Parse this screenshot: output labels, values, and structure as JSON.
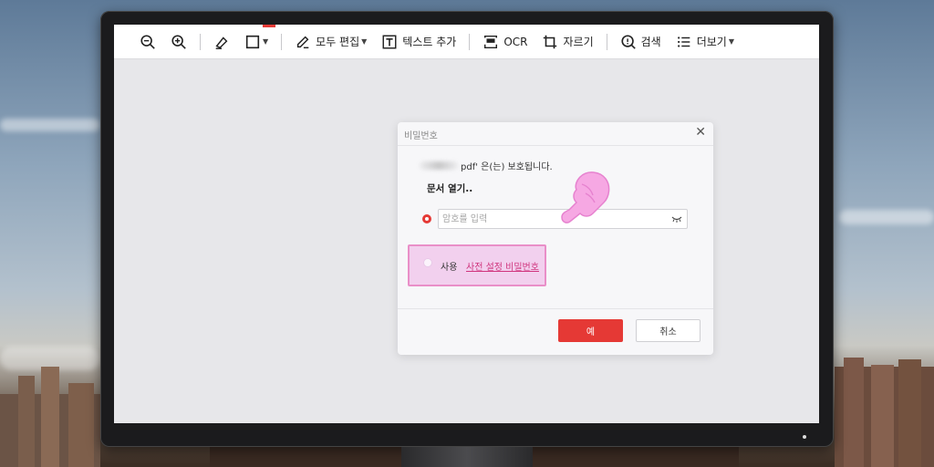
{
  "toolbar": {
    "items": [
      {
        "id": "zoom-out",
        "icon": "zoom-out-icon",
        "label": ""
      },
      {
        "id": "zoom-in",
        "icon": "zoom-in-icon",
        "label": ""
      },
      {
        "id": "highlight",
        "icon": "highlighter-icon",
        "label": ""
      },
      {
        "id": "shape",
        "icon": "rectangle-icon",
        "label": ""
      },
      {
        "id": "edit-all",
        "icon": "edit-icon",
        "label": "모두 편집"
      },
      {
        "id": "add-text",
        "icon": "text-box-icon",
        "label": "텍스트 추가"
      },
      {
        "id": "ocr",
        "icon": "ocr-icon",
        "label": "OCR"
      },
      {
        "id": "crop",
        "icon": "crop-icon",
        "label": "자르기"
      },
      {
        "id": "search",
        "icon": "search-icon",
        "label": "검색"
      },
      {
        "id": "more",
        "icon": "list-icon",
        "label": "더보기"
      }
    ],
    "accent_color": "#e53935"
  },
  "dialog": {
    "title": "비밀번호",
    "message": "pdf' 은(는) 보호됩니다.",
    "open_title": "문서 열기..",
    "password_placeholder": "암호를 입력",
    "use_label": "사용",
    "preset_link": "사전 설정 비밀번호",
    "ok_label": "예",
    "cancel_label": "취소",
    "close_icon": "close-icon",
    "highlight_color": "#e98fc8"
  }
}
